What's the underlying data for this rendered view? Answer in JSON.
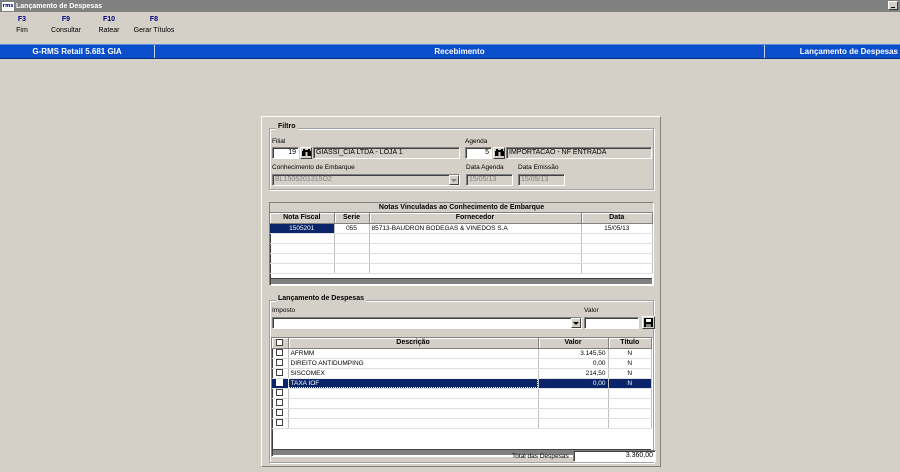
{
  "window": {
    "title": "Lançamento de Despesas",
    "logo": "rms"
  },
  "fkeys": [
    {
      "key": "F3",
      "label": "Fim"
    },
    {
      "key": "F9",
      "label": "Consultar"
    },
    {
      "key": "F10",
      "label": "Ratear"
    },
    {
      "key": "F8",
      "label": "Gerar Títulos"
    }
  ],
  "header": {
    "app": "G-RMS Retail 5.681 GIA",
    "module": "Recebimento",
    "screen": "Lançamento de Despesas"
  },
  "filtro": {
    "title": "Filtro",
    "filial_label": "Filial",
    "filial_code": "19",
    "filial_name": "GIASSI_CIA LTDA - LOJA 1",
    "agenda_label": "Agenda",
    "agenda_code": "5",
    "agenda_name": "IMPORTACAO - NF ENTRADA",
    "conhecimento_label": "Conhecimento de Embarque",
    "conhecimento_value": "BL1505201315O2",
    "data_agenda_label": "Data Agenda",
    "data_agenda_value": "15/05/13",
    "data_emissao_label": "Data Emissão",
    "data_emissao_value": "15/05/13"
  },
  "notas": {
    "caption": "Notas Vinculadas ao Conhecimento de Embarque",
    "columns": [
      "Nota Fiscal",
      "Serie",
      "Fornecedor",
      "Data"
    ],
    "rows": [
      {
        "nota": "1505201",
        "serie": "055",
        "fornecedor": "85713-BAUDRON BODEGAS & VINEDOS S.A",
        "data": "15/05/13"
      }
    ]
  },
  "lancamento": {
    "title": "Lançamento de Despesas",
    "imposto_label": "Imposto",
    "imposto_value": "",
    "valor_label": "Valor",
    "valor_value": "",
    "columns": [
      "Descrição",
      "Valor",
      "Título"
    ],
    "rows": [
      {
        "descricao": "AFRMM",
        "valor": "3.145,50",
        "titulo": "N"
      },
      {
        "descricao": "DIREITO ANTIDUMPING",
        "valor": "0,00",
        "titulo": "N"
      },
      {
        "descricao": "SISCOMEX",
        "valor": "214,50",
        "titulo": "N"
      },
      {
        "descricao": "TAXA IOF",
        "valor": "0,00",
        "titulo": "N"
      }
    ],
    "total_label": "Total das Despesas",
    "total_value": "3.360,00"
  }
}
